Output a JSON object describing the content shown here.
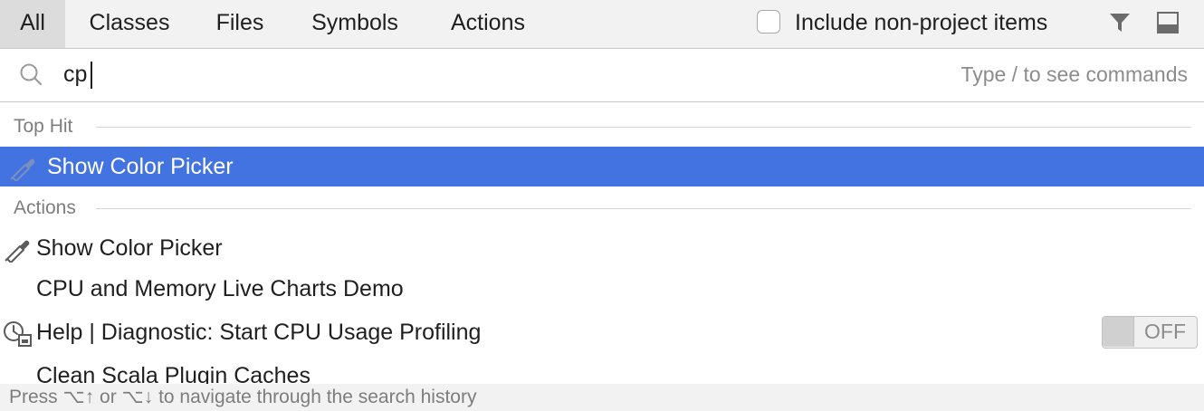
{
  "tabs": [
    {
      "label": "All",
      "active": true
    },
    {
      "label": "Classes"
    },
    {
      "label": "Files"
    },
    {
      "label": "Symbols"
    },
    {
      "label": "Actions"
    }
  ],
  "options": {
    "include_non_project_label": "Include non-project items",
    "include_non_project_checked": false,
    "filter_icon": "filter-icon",
    "dock_icon": "dock-window-icon"
  },
  "search": {
    "value": "cp",
    "hint": "Type / to see commands",
    "icon": "search-icon"
  },
  "sections": {
    "top_hit": "Top Hit",
    "actions": "Actions"
  },
  "top_hit": {
    "label": "Show Color Picker",
    "icon": "color-picker-icon"
  },
  "results": [
    {
      "label": "Show Color Picker",
      "icon": "color-picker-icon"
    },
    {
      "label": "CPU and Memory Live Charts Demo"
    },
    {
      "label": "Help | Diagnostic: Start CPU Usage Profiling",
      "icon": "profiling-clock-icon",
      "toggle": "OFF"
    },
    {
      "label": "Clean Scala Plugin Caches"
    }
  ],
  "footer": {
    "text": "Press ⌥↑ or ⌥↓ to navigate through the search history"
  },
  "colors": {
    "selection": "#4373e0",
    "tabbar_bg": "#f2f2f2",
    "active_tab_bg": "#dcdcdc"
  }
}
